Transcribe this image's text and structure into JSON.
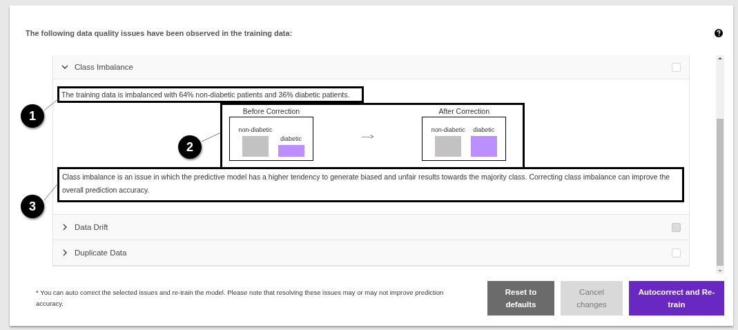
{
  "heading": "The following data quality issues have been observed in the training data:",
  "issues": [
    {
      "title": "Class Imbalance",
      "expanded": true,
      "checked": false,
      "disabled": false,
      "summary": "The training data is imbalanced with 64% non-diabetic patients and 36% diabetic patients.",
      "comparison": {
        "before": {
          "title": "Before Correction",
          "labels": [
            "non-diabetic",
            "diabetic"
          ]
        },
        "arrow": "---->",
        "after": {
          "title": "After Correction",
          "labels": [
            "non-diabetic",
            "diabetic"
          ]
        }
      },
      "description": "Class imbalance is an issue in which the predictive model has a higher tendency to generate biased and unfair results towards the majority class. Correcting class imbalance can improve the overall prediction accuracy."
    },
    {
      "title": "Data Drift",
      "expanded": false,
      "checked": false,
      "disabled": true
    },
    {
      "title": "Duplicate Data",
      "expanded": false,
      "checked": false,
      "disabled": false
    }
  ],
  "callouts": [
    "1",
    "2",
    "3"
  ],
  "footnote": "* You can auto correct the selected issues and re-train the model. Please note that resolving these issues may or may not improve prediction accuracy.",
  "buttons": [
    {
      "label": "Reset to defaults",
      "kind": "secondary"
    },
    {
      "label": "Cancel changes",
      "kind": "disabled"
    },
    {
      "label": "Autocorrect and Re-train",
      "kind": "primary"
    }
  ]
}
